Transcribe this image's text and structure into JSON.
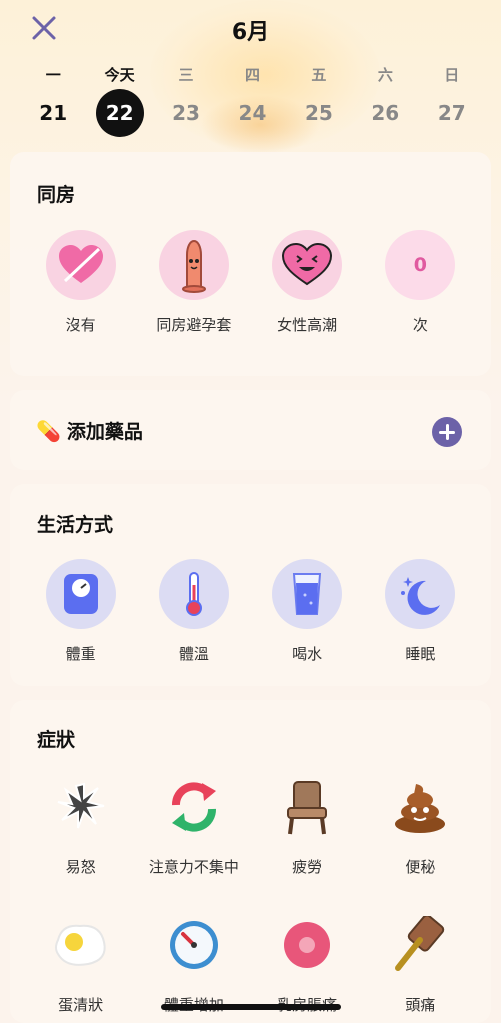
{
  "header": {
    "month": "6月"
  },
  "week": {
    "days": [
      "一",
      "今天",
      "三",
      "四",
      "五",
      "六",
      "日"
    ],
    "dates": [
      "21",
      "22",
      "23",
      "24",
      "25",
      "26",
      "27"
    ],
    "selected_index": 1
  },
  "intercourse": {
    "title": "同房",
    "items": [
      {
        "label": "沒有",
        "icon": "crossed-heart-icon"
      },
      {
        "label": "同房避孕套",
        "icon": "condom-icon"
      },
      {
        "label": "女性高潮",
        "icon": "smiling-heart-icon"
      },
      {
        "label": "次",
        "value": "0",
        "icon": "count-circle"
      }
    ]
  },
  "medicine": {
    "emoji": "💊",
    "title": "添加藥品"
  },
  "lifestyle": {
    "title": "生活方式",
    "items": [
      {
        "label": "體重",
        "icon": "scale-icon"
      },
      {
        "label": "體溫",
        "icon": "thermometer-icon"
      },
      {
        "label": "喝水",
        "icon": "water-glass-icon"
      },
      {
        "label": "睡眠",
        "icon": "moon-icon"
      }
    ]
  },
  "symptoms": {
    "title": "症狀",
    "items": [
      {
        "label": "易怒",
        "icon": "anger-icon"
      },
      {
        "label": "注意力不集中",
        "icon": "refresh-arrows-icon"
      },
      {
        "label": "疲勞",
        "icon": "chair-icon"
      },
      {
        "label": "便秘",
        "icon": "poop-icon"
      },
      {
        "label": "蛋清狀",
        "icon": "egg-icon"
      },
      {
        "label": "體重增加",
        "icon": "gauge-icon"
      },
      {
        "label": "乳房脹痛",
        "icon": "breast-icon"
      },
      {
        "label": "頭痛",
        "icon": "hammer-icon"
      }
    ]
  },
  "colors": {
    "accent": "#6c62a8",
    "pink": "#f06aa6",
    "lavender": "#dcdcf3"
  }
}
